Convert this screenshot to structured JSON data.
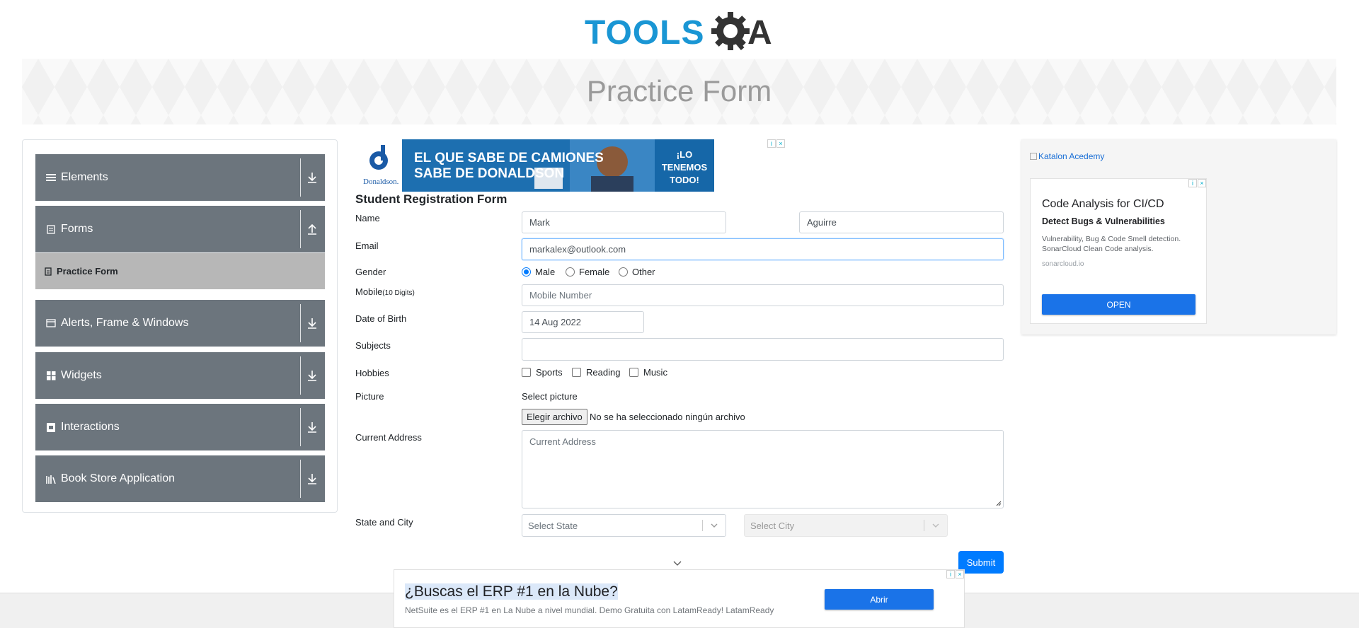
{
  "logo": {
    "text": "TOOLSQA",
    "tools": "TOOLS",
    "qa": "QA",
    "colors": {
      "tools": "#1a96d4",
      "qa": "#333333"
    }
  },
  "banner": {
    "title": "Practice Form"
  },
  "sidebar": {
    "groups": [
      {
        "label": "Elements",
        "icon": "menu-icon",
        "arrow": "download-icon"
      },
      {
        "label": "Forms",
        "icon": "document-icon",
        "arrow": "upload-icon",
        "sub_items": [
          {
            "label": "Practice Form",
            "active": true
          }
        ]
      },
      {
        "label": "Alerts, Frame & Windows",
        "icon": "window-icon",
        "arrow": "download-icon"
      },
      {
        "label": "Widgets",
        "icon": "grid-icon",
        "arrow": "download-icon"
      },
      {
        "label": "Interactions",
        "icon": "hand-icon",
        "arrow": "download-icon"
      },
      {
        "label": "Book Store Application",
        "icon": "books-icon",
        "arrow": "download-icon"
      }
    ],
    "colors": {
      "group_bg": "#6c757d",
      "active_bg": "#b7b7b7"
    }
  },
  "top_ad": {
    "brand": "Donaldson.",
    "line1": "EL QUE SABE DE CAMIONES",
    "line2": "SABE DE DONALDSON",
    "cta1": "¡LO",
    "cta2": "TENEMOS",
    "cta3": "TODO!"
  },
  "form": {
    "title": "Student Registration Form",
    "labels": {
      "name": "Name",
      "email": "Email",
      "gender": "Gender",
      "mobile": "Mobile",
      "mobile_hint": "(10 Digits)",
      "dob": "Date of Birth",
      "subjects": "Subjects",
      "hobbies": "Hobbies",
      "picture": "Picture",
      "address": "Current Address",
      "state_city": "State and City"
    },
    "first_name": "Mark",
    "last_name": "Aguirre",
    "email": "markalex@outlook.com",
    "gender_options": [
      "Male",
      "Female",
      "Other"
    ],
    "gender_selected": "Male",
    "mobile_placeholder": "Mobile Number",
    "dob": "14 Aug 2022",
    "subjects": "",
    "hobbies": [
      "Sports",
      "Reading",
      "Music"
    ],
    "picture_label": "Select picture",
    "file_button": "Elegir archivo",
    "file_status": "No se ha seleccionado ningún archivo",
    "address_placeholder": "Current Address",
    "state_placeholder": "Select State",
    "city_placeholder": "Select City",
    "submit": "Submit",
    "accent": "#007bff"
  },
  "right_ad": {
    "alt_link": "Katalon Acedemy",
    "title": "Code Analysis for CI/CD",
    "subtitle": "Detect Bugs & Vulnerabilities",
    "desc": "Vulnerability, Bug & Code Smell detection. SonarCloud Clean Code analysis.",
    "domain": "sonarcloud.io",
    "cta": "OPEN"
  },
  "bottom_ad": {
    "headline": "¿Buscas el ERP #1 en la Nube?",
    "desc": "NetSuite es el ERP #1 en La Nube a nivel mundial. Demo Gratuita con LatamReady! LatamReady",
    "cta": "Abrir"
  }
}
